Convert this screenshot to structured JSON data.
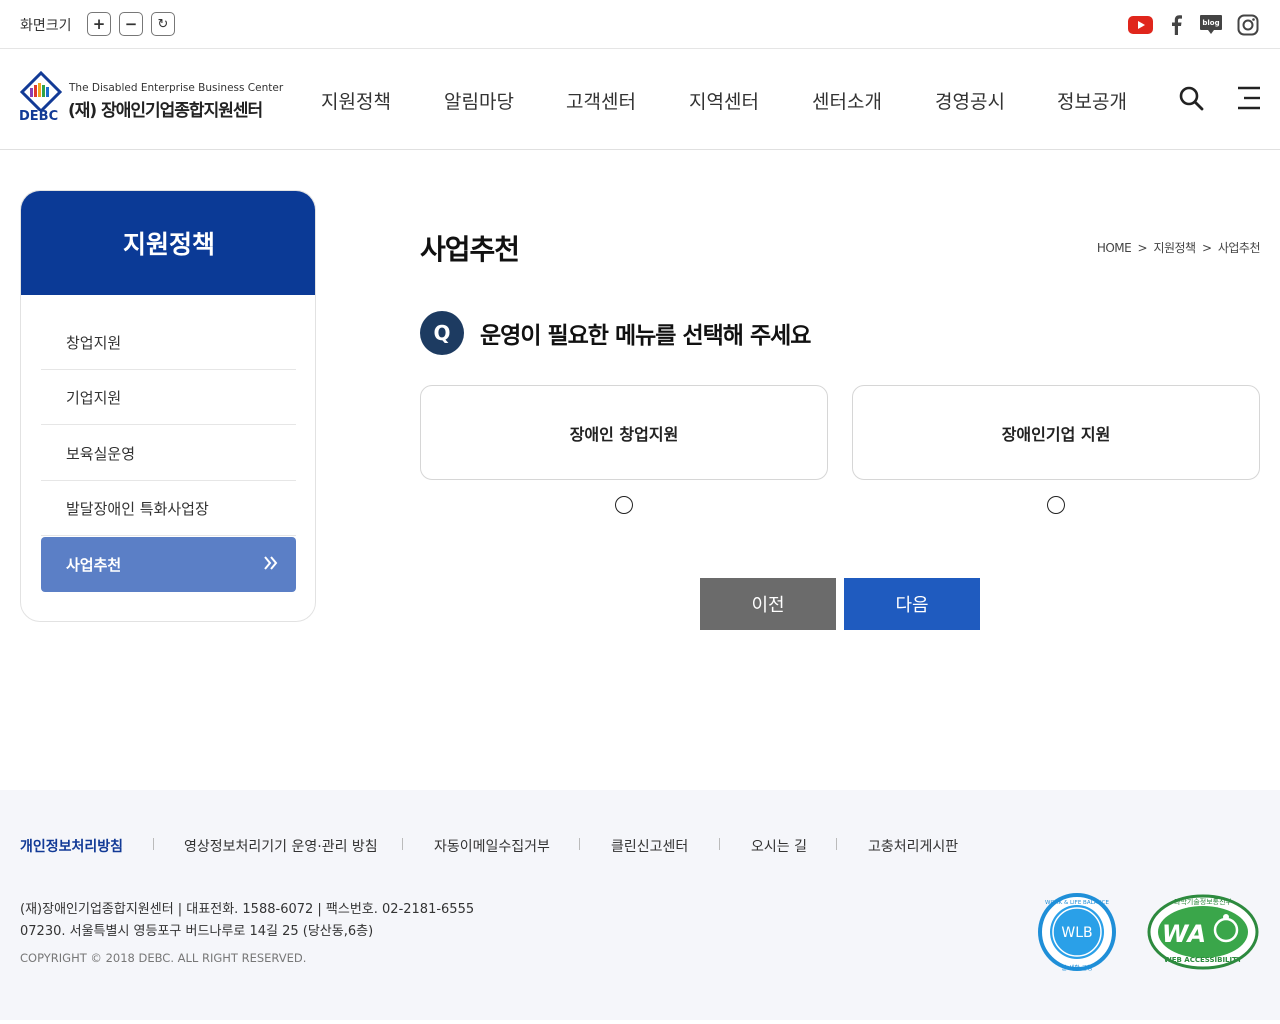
{
  "util": {
    "zoom_label": "화면크기",
    "zoom_in": "+",
    "zoom_out": "−",
    "zoom_reset": "↻",
    "social_icons": [
      "youtube-icon",
      "facebook-icon",
      "blog-icon",
      "instagram-icon"
    ],
    "blog_text": "blog"
  },
  "header": {
    "logo_en": "The Disabled Enterprise Business Center",
    "logo_ko": "(재) 장애인기업종합지원센터",
    "logo_short": "DEBC",
    "nav": [
      "지원정책",
      "알림마당",
      "고객센터",
      "지역센터",
      "센터소개",
      "경영공시",
      "정보공개"
    ]
  },
  "sidebar": {
    "title": "지원정책",
    "items": [
      {
        "label": "창업지원"
      },
      {
        "label": "기업지원"
      },
      {
        "label": "보육실운영"
      },
      {
        "label": "발달장애인 특화사업장"
      },
      {
        "label": "사업추천",
        "active": true
      }
    ]
  },
  "main": {
    "title": "사업추천",
    "breadcrumb": [
      "HOME",
      "지원정책",
      "사업추천"
    ],
    "breadcrumb_sep": ">",
    "question_badge": "Q",
    "question": "운영이 필요한 메뉴를 선택해 주세요",
    "options": [
      {
        "label": "장애인 창업지원",
        "selected": false
      },
      {
        "label": "장애인기업 지원",
        "selected": false
      }
    ],
    "prev_label": "이전",
    "next_label": "다음"
  },
  "footer": {
    "links": [
      "개인정보처리방침",
      "영상정보처리기기 운영·관리 방침",
      "자동이메일수집거부",
      "클린신고센터",
      "오시는 길",
      "고충처리게시판"
    ],
    "info_line1": "(재)장애인기업종합지원센터  | 대표전화. 1588-6072 | 팩스번호. 02-2181-6555",
    "info_line2": "07230. 서울특별시 영등포구 버드나루로 14길 25 (당산동,6층)",
    "copyright": "COPYRIGHT © 2018 DEBC. ALL RIGHT RESERVED.",
    "cert_wlb_text": "WORK & LIFE BALANCE",
    "cert_wlb_mark": "WLB",
    "cert_wlb_sub": "일·생활 균형",
    "cert_wa_top": "과학기술정보통신부",
    "cert_wa_mark": "WA",
    "cert_wa_sub": "WEB ACCESSIBILITY"
  },
  "colors": {
    "primary": "#0b3a96",
    "sidebar_active": "#5b7fc6",
    "next_button": "#1f5bbf",
    "prev_button": "#6b6b6b",
    "q_badge": "#1d3b61",
    "youtube": "#e0261c"
  }
}
